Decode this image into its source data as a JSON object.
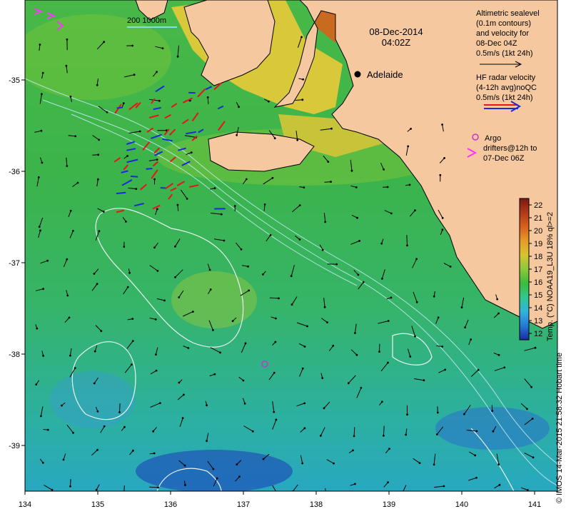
{
  "map": {
    "title_date": "08-Dec-2014",
    "title_time": "04:02Z",
    "scale_label": "200  1000m",
    "city": "Adelaide",
    "lon_ticks": [
      "134",
      "135",
      "136",
      "137",
      "138",
      "139",
      "140",
      "141"
    ],
    "lat_ticks": [
      "-35",
      "-36",
      "-37",
      "-38",
      "-39"
    ],
    "lat_range": [
      -39.5,
      -34.3
    ],
    "lon_range": [
      134,
      141.3
    ]
  },
  "legend": {
    "alt_line1": "Altimetric sealevel",
    "alt_line2": "(0.1m contours)",
    "alt_line3": "and velocity for",
    "alt_line4": "08-Dec 04Z",
    "alt_line5": "0.5m/s (1kt 24h)",
    "hf_line1": "HF radar velocity",
    "hf_line2": "(4-12h avg)noQC",
    "hf_line3": "0.5m/s (1kt 24h)",
    "argo_line1": "Argo",
    "argo_line2": "drifters@12h to",
    "argo_line3": "07-Dec 06Z",
    "colors": {
      "alt_arrow": "#000000",
      "hf_red": "#e8141a",
      "hf_blue": "#1a2ad8",
      "argo": "#cc33cc",
      "drifter": "#ff33ff"
    }
  },
  "colorbar": {
    "label": "Temp. (°C) NOAA19_L3U 18% ql>=2",
    "ticks": [
      "22",
      "21",
      "20",
      "19",
      "18",
      "17",
      "16",
      "15",
      "14",
      "13",
      "12"
    ],
    "colors": [
      "#7a1a10",
      "#b03a18",
      "#d8601c",
      "#e89a2a",
      "#d8c430",
      "#8cc83c",
      "#3cbc3c",
      "#30c890",
      "#30b4dc",
      "#2878d8",
      "#1a2aa0"
    ]
  },
  "credit": "© IMOS 14-Mar-2015 21:58:32 Hobart time"
}
